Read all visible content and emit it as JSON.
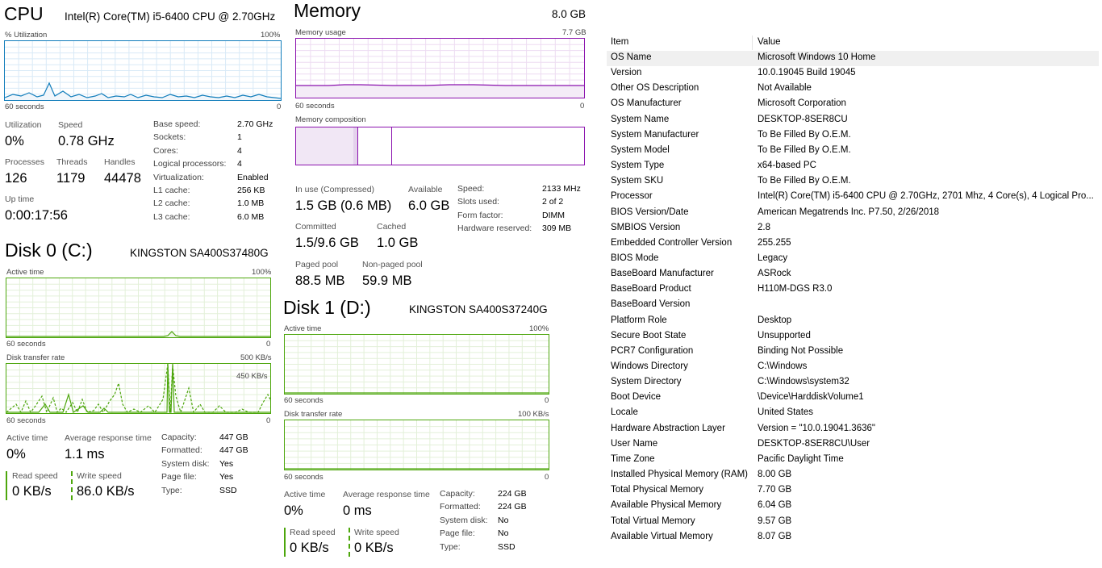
{
  "cpu": {
    "title": "CPU",
    "model": "Intel(R) Core(TM) i5-6400 CPU @ 2.70GHz",
    "util_label": "% Utilization",
    "max_label": "100%",
    "time_label": "60 seconds",
    "zero_label": "0",
    "stats": {
      "utilization_label": "Utilization",
      "utilization": "0%",
      "speed_label": "Speed",
      "speed": "0.78 GHz",
      "processes_label": "Processes",
      "processes": "126",
      "threads_label": "Threads",
      "threads": "1179",
      "handles_label": "Handles",
      "handles": "44478",
      "uptime_label": "Up time",
      "uptime": "0:00:17:56"
    },
    "details": [
      {
        "k": "Base speed:",
        "v": "2.70 GHz"
      },
      {
        "k": "Sockets:",
        "v": "1"
      },
      {
        "k": "Cores:",
        "v": "4"
      },
      {
        "k": "Logical processors:",
        "v": "4"
      },
      {
        "k": "Virtualization:",
        "v": "Enabled"
      },
      {
        "k": "L1 cache:",
        "v": "256 KB"
      },
      {
        "k": "L2 cache:",
        "v": "1.0 MB"
      },
      {
        "k": "L3 cache:",
        "v": "6.0 MB"
      }
    ],
    "color": "#117dbb"
  },
  "memory": {
    "title": "Memory",
    "total": "8.0 GB",
    "usage_label": "Memory usage",
    "usage_max": "7.7 GB",
    "time_label": "60 seconds",
    "zero_label": "0",
    "composition_label": "Memory composition",
    "stats": {
      "inuse_label": "In use (Compressed)",
      "inuse": "1.5 GB (0.6 MB)",
      "available_label": "Available",
      "available": "6.0 GB",
      "committed_label": "Committed",
      "committed": "1.5/9.6 GB",
      "cached_label": "Cached",
      "cached": "1.0 GB",
      "paged_label": "Paged pool",
      "paged": "88.5 MB",
      "nonpaged_label": "Non-paged pool",
      "nonpaged": "59.9 MB"
    },
    "details": [
      {
        "k": "Speed:",
        "v": "2133 MHz"
      },
      {
        "k": "Slots used:",
        "v": "2 of 2"
      },
      {
        "k": "Form factor:",
        "v": "DIMM"
      },
      {
        "k": "Hardware reserved:",
        "v": "309 MB"
      }
    ],
    "color": "#8b12ae"
  },
  "disk0": {
    "title": "Disk 0 (C:)",
    "model": "KINGSTON SA400S37480G",
    "active_label": "Active time",
    "max_label": "100%",
    "time_label": "60 seconds",
    "zero_label": "0",
    "transfer_label": "Disk transfer rate",
    "transfer_max": "500 KB/s",
    "transfer_mark": "450 KB/s",
    "stats": {
      "active_label": "Active time",
      "active": "0%",
      "resp_label": "Average response time",
      "resp": "1.1 ms",
      "read_label": "Read speed",
      "read": "0 KB/s",
      "write_label": "Write speed",
      "write": "86.0 KB/s"
    },
    "details": [
      {
        "k": "Capacity:",
        "v": "447 GB"
      },
      {
        "k": "Formatted:",
        "v": "447 GB"
      },
      {
        "k": "System disk:",
        "v": "Yes"
      },
      {
        "k": "Page file:",
        "v": "Yes"
      },
      {
        "k": "Type:",
        "v": "SSD"
      }
    ],
    "color": "#4da60c"
  },
  "disk1": {
    "title": "Disk 1 (D:)",
    "model": "KINGSTON SA400S37240G",
    "active_label": "Active time",
    "max_label": "100%",
    "time_label": "60 seconds",
    "zero_label": "0",
    "transfer_label": "Disk transfer rate",
    "transfer_max": "100 KB/s",
    "stats": {
      "active_label": "Active time",
      "active": "0%",
      "resp_label": "Average response time",
      "resp": "0 ms",
      "read_label": "Read speed",
      "read": "0 KB/s",
      "write_label": "Write speed",
      "write": "0 KB/s"
    },
    "details": [
      {
        "k": "Capacity:",
        "v": "224 GB"
      },
      {
        "k": "Formatted:",
        "v": "224 GB"
      },
      {
        "k": "System disk:",
        "v": "No"
      },
      {
        "k": "Page file:",
        "v": "No"
      },
      {
        "k": "Type:",
        "v": "SSD"
      }
    ],
    "color": "#4da60c"
  },
  "sysinfo": {
    "header_item": "Item",
    "header_value": "Value",
    "rows": [
      {
        "k": "OS Name",
        "v": "Microsoft Windows 10 Home"
      },
      {
        "k": "Version",
        "v": "10.0.19045 Build 19045"
      },
      {
        "k": "Other OS Description",
        "v": "Not Available"
      },
      {
        "k": "OS Manufacturer",
        "v": "Microsoft Corporation"
      },
      {
        "k": "System Name",
        "v": "DESKTOP-8SER8CU"
      },
      {
        "k": "System Manufacturer",
        "v": "To Be Filled By O.E.M."
      },
      {
        "k": "System Model",
        "v": "To Be Filled By O.E.M."
      },
      {
        "k": "System Type",
        "v": "x64-based PC"
      },
      {
        "k": "System SKU",
        "v": "To Be Filled By O.E.M."
      },
      {
        "k": "Processor",
        "v": "Intel(R) Core(TM) i5-6400 CPU @ 2.70GHz, 2701 Mhz, 4 Core(s), 4 Logical Pro..."
      },
      {
        "k": "BIOS Version/Date",
        "v": "American Megatrends Inc. P7.50, 2/26/2018"
      },
      {
        "k": "SMBIOS Version",
        "v": "2.8"
      },
      {
        "k": "Embedded Controller Version",
        "v": "255.255"
      },
      {
        "k": "BIOS Mode",
        "v": "Legacy"
      },
      {
        "k": "BaseBoard Manufacturer",
        "v": "ASRock"
      },
      {
        "k": "BaseBoard Product",
        "v": "H110M-DGS R3.0"
      },
      {
        "k": "BaseBoard Version",
        "v": ""
      },
      {
        "k": "Platform Role",
        "v": "Desktop"
      },
      {
        "k": "Secure Boot State",
        "v": "Unsupported"
      },
      {
        "k": "PCR7 Configuration",
        "v": "Binding Not Possible"
      },
      {
        "k": "Windows Directory",
        "v": "C:\\Windows"
      },
      {
        "k": "System Directory",
        "v": "C:\\Windows\\system32"
      },
      {
        "k": "Boot Device",
        "v": "\\Device\\HarddiskVolume1"
      },
      {
        "k": "Locale",
        "v": "United States"
      },
      {
        "k": "Hardware Abstraction Layer",
        "v": "Version = \"10.0.19041.3636\""
      },
      {
        "k": "User Name",
        "v": "DESKTOP-8SER8CU\\User"
      },
      {
        "k": "Time Zone",
        "v": "Pacific Daylight Time"
      },
      {
        "k": "Installed Physical Memory (RAM)",
        "v": "8.00 GB"
      },
      {
        "k": "Total Physical Memory",
        "v": "7.70 GB"
      },
      {
        "k": "Available Physical Memory",
        "v": "6.04 GB"
      },
      {
        "k": "Total Virtual Memory",
        "v": "9.57 GB"
      },
      {
        "k": "Available Virtual Memory",
        "v": "8.07 GB"
      }
    ],
    "selected_row": 0
  }
}
